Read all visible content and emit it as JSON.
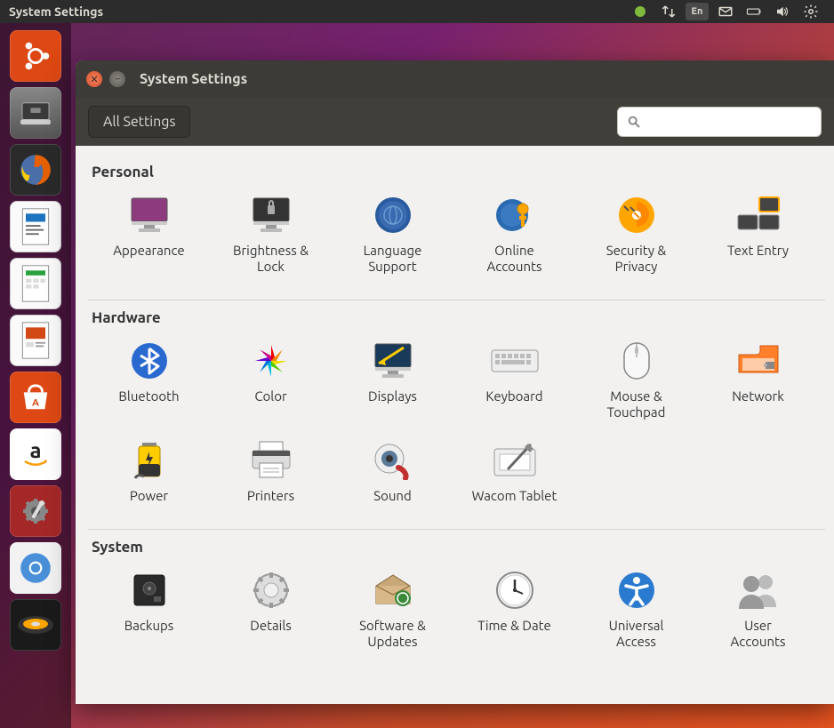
{
  "menubar": {
    "title": "System Settings",
    "language_indicator": "En"
  },
  "launcher": {
    "items": [
      {
        "name": "dash",
        "color": "#dd4814"
      },
      {
        "name": "files",
        "color": "#6b6763"
      },
      {
        "name": "firefox",
        "color": "#2a2a2a"
      },
      {
        "name": "writer",
        "color": "#1b74bd"
      },
      {
        "name": "calc",
        "color": "#2aa13f"
      },
      {
        "name": "impress",
        "color": "#d24915"
      },
      {
        "name": "software",
        "color": "#dd4814"
      },
      {
        "name": "amazon",
        "color": "#ffffff"
      },
      {
        "name": "settings",
        "color": "#a52828"
      },
      {
        "name": "chromium",
        "color": "#4a90d9"
      },
      {
        "name": "media",
        "color": "#222222"
      }
    ]
  },
  "window": {
    "title": "System Settings",
    "all_settings_label": "All Settings",
    "search_placeholder": ""
  },
  "sections": [
    {
      "title": "Personal",
      "items": [
        {
          "id": "appearance",
          "label": "Appearance"
        },
        {
          "id": "brightness-lock",
          "label": "Brightness &\nLock"
        },
        {
          "id": "language-support",
          "label": "Language\nSupport"
        },
        {
          "id": "online-accounts",
          "label": "Online\nAccounts"
        },
        {
          "id": "security-privacy",
          "label": "Security &\nPrivacy"
        },
        {
          "id": "text-entry",
          "label": "Text Entry"
        }
      ]
    },
    {
      "title": "Hardware",
      "items": [
        {
          "id": "bluetooth",
          "label": "Bluetooth"
        },
        {
          "id": "color",
          "label": "Color"
        },
        {
          "id": "displays",
          "label": "Displays"
        },
        {
          "id": "keyboard",
          "label": "Keyboard"
        },
        {
          "id": "mouse-touchpad",
          "label": "Mouse &\nTouchpad"
        },
        {
          "id": "network",
          "label": "Network"
        },
        {
          "id": "power",
          "label": "Power"
        },
        {
          "id": "printers",
          "label": "Printers"
        },
        {
          "id": "sound",
          "label": "Sound"
        },
        {
          "id": "wacom-tablet",
          "label": "Wacom Tablet"
        }
      ]
    },
    {
      "title": "System",
      "items": [
        {
          "id": "backups",
          "label": "Backups"
        },
        {
          "id": "details",
          "label": "Details"
        },
        {
          "id": "software-updates",
          "label": "Software &\nUpdates"
        },
        {
          "id": "time-date",
          "label": "Time & Date"
        },
        {
          "id": "universal-access",
          "label": "Universal\nAccess"
        },
        {
          "id": "user-accounts",
          "label": "User\nAccounts"
        }
      ]
    }
  ]
}
